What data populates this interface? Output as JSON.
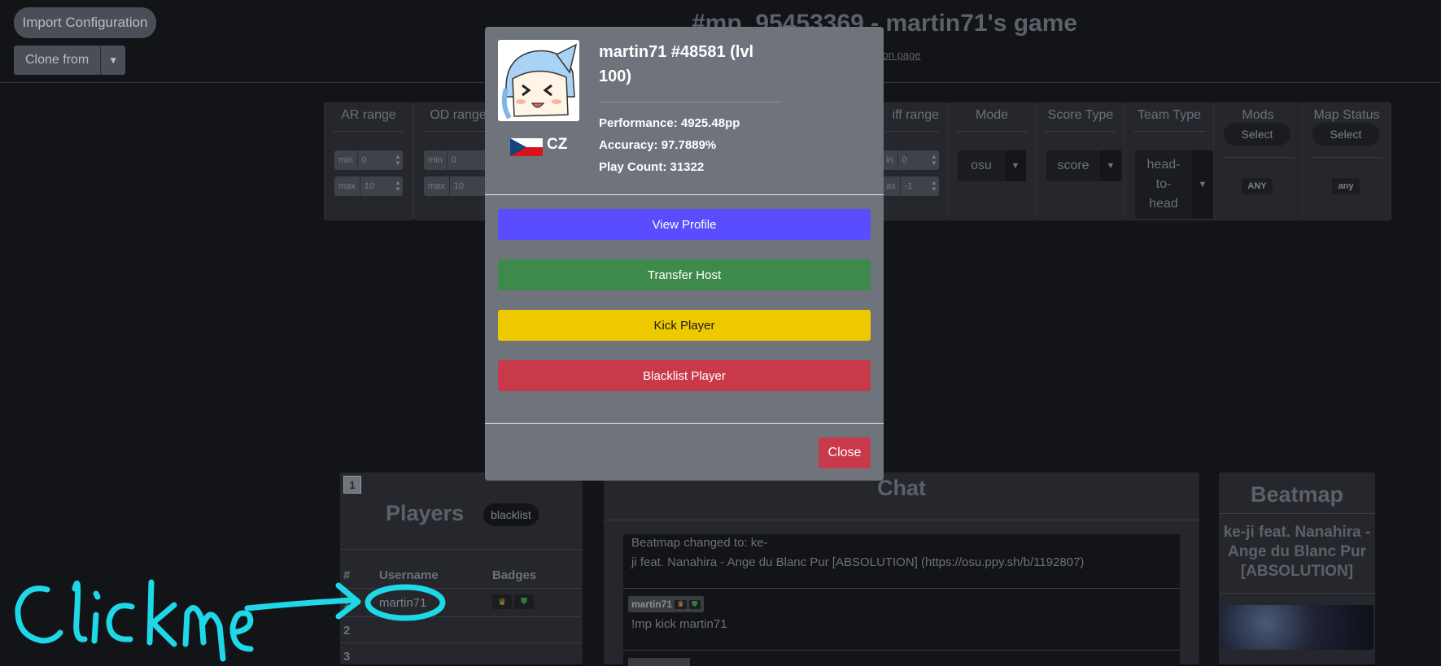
{
  "header": {
    "import_label": "Import Configuration",
    "clone_label": "Clone from",
    "title": "#mp_95453369 - martin71's game",
    "sublink": "tion page"
  },
  "filters": {
    "ar": {
      "title": "AR range",
      "min_key": "min",
      "min_val": "0",
      "max_key": "max",
      "max_val": "10"
    },
    "od": {
      "title": "OD range",
      "min_key": "min",
      "min_val": "0",
      "max_key": "max",
      "max_val": "10"
    },
    "diff": {
      "title": "iff range",
      "min_key": "in",
      "min_val": "0",
      "max_key": "ax",
      "max_val": "-1"
    },
    "mode": {
      "title": "Mode",
      "value": "osu"
    },
    "score": {
      "title": "Score Type",
      "value": "score"
    },
    "team": {
      "title": "Team Type",
      "value": "head-\nto-\nhead"
    },
    "mods": {
      "title": "Mods",
      "button": "Select",
      "tag": "ANY"
    },
    "status": {
      "title": "Map Status",
      "button": "Select",
      "tag": "any"
    }
  },
  "players": {
    "page": "1",
    "title": "Players",
    "blacklist_label": "blacklist",
    "col_num": "#",
    "col_user": "Username",
    "col_badges": "Badges",
    "rows": [
      {
        "num": "1",
        "username": "martin71"
      },
      {
        "num": "2",
        "username": ""
      },
      {
        "num": "3",
        "username": ""
      }
    ]
  },
  "chat": {
    "title": "Chat",
    "msg1_line1": "Beatmap changed to: ke-",
    "msg1_line2": "ji feat. Nanahira - Ange du Blanc Pur [ABSOLUTION] (https://osu.ppy.sh/b/1192807)",
    "msg2_user": "martin71",
    "msg2_text": "!mp kick martin71"
  },
  "beatmap": {
    "title": "Beatmap",
    "name": "ke-ji feat. Nanahira - Ange du Blanc Pur [ABSOLUTION]"
  },
  "modal": {
    "name": "martin71 #48581 (lvl 100)",
    "performance": "Performance: 4925.48pp",
    "accuracy": "Accuracy: 97.7889%",
    "play_count": "Play Count: 31322",
    "country": "CZ",
    "view_profile": "View Profile",
    "transfer_host": "Transfer Host",
    "kick_player": "Kick Player",
    "blacklist_player": "Blacklist Player",
    "close": "Close",
    "colors": {
      "view": "#5a4dff",
      "transfer": "#3e8a4b",
      "kick": "#efc900",
      "blacklist": "#c8394a"
    }
  },
  "annotation": {
    "text": "click me"
  }
}
